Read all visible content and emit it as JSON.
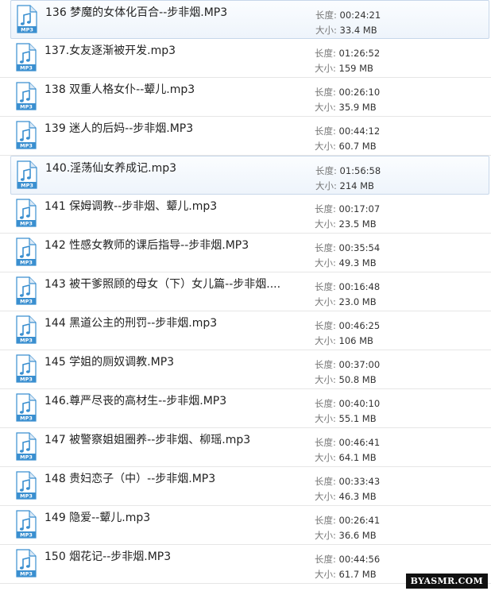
{
  "labels": {
    "duration": "长度:",
    "size": "大小:",
    "icon_badge": "MP3"
  },
  "files": [
    {
      "name": "136 梦魔的女体化百合--步非烟.MP3",
      "duration": "00:24:21",
      "size": "33.4 MB",
      "highlight": true
    },
    {
      "name": "137.女友逐渐被开发.mp3",
      "duration": "01:26:52",
      "size": "159 MB",
      "highlight": false
    },
    {
      "name": "138 双重人格女仆--颦儿.mp3",
      "duration": "00:26:10",
      "size": "35.9 MB",
      "highlight": false
    },
    {
      "name": "139 迷人的后妈--步非烟.MP3",
      "duration": "00:44:12",
      "size": "60.7 MB",
      "highlight": false
    },
    {
      "name": "140.淫荡仙女养成记.mp3",
      "duration": "01:56:58",
      "size": "214 MB",
      "highlight": true
    },
    {
      "name": "141 保姆调教--步非烟、颦儿.mp3",
      "duration": "00:17:07",
      "size": "23.5 MB",
      "highlight": false
    },
    {
      "name": "142 性感女教师的课后指导--步非烟.MP3",
      "duration": "00:35:54",
      "size": "49.3 MB",
      "highlight": false
    },
    {
      "name": "143 被干爹照顾的母女（下）女儿篇--步非烟....",
      "duration": "00:16:48",
      "size": "23.0 MB",
      "highlight": false
    },
    {
      "name": "144 黑道公主的刑罚--步非烟.mp3",
      "duration": "00:46:25",
      "size": "106 MB",
      "highlight": false
    },
    {
      "name": "145 学姐的厕奴调教.MP3",
      "duration": "00:37:00",
      "size": "50.8 MB",
      "highlight": false
    },
    {
      "name": "146.尊严尽丧的高材生--步非烟.MP3",
      "duration": "00:40:10",
      "size": "55.1 MB",
      "highlight": false
    },
    {
      "name": "147 被警察姐姐圈养--步非烟、柳瑶.mp3",
      "duration": "00:46:41",
      "size": "64.1 MB",
      "highlight": false
    },
    {
      "name": "148 贵妇恋子（中）--步非烟.MP3",
      "duration": "00:33:43",
      "size": "46.3 MB",
      "highlight": false
    },
    {
      "name": "149 隐爱--颦儿.mp3",
      "duration": "00:26:41",
      "size": "36.6 MB",
      "highlight": false
    },
    {
      "name": "150 烟花记--步非烟.MP3",
      "duration": "00:44:56",
      "size": "61.7 MB",
      "highlight": false
    }
  ],
  "icon_name": "mp3-file-icon",
  "colors": {
    "icon_accent": "#3a8fd0"
  },
  "watermark": "BYASMR.COM"
}
